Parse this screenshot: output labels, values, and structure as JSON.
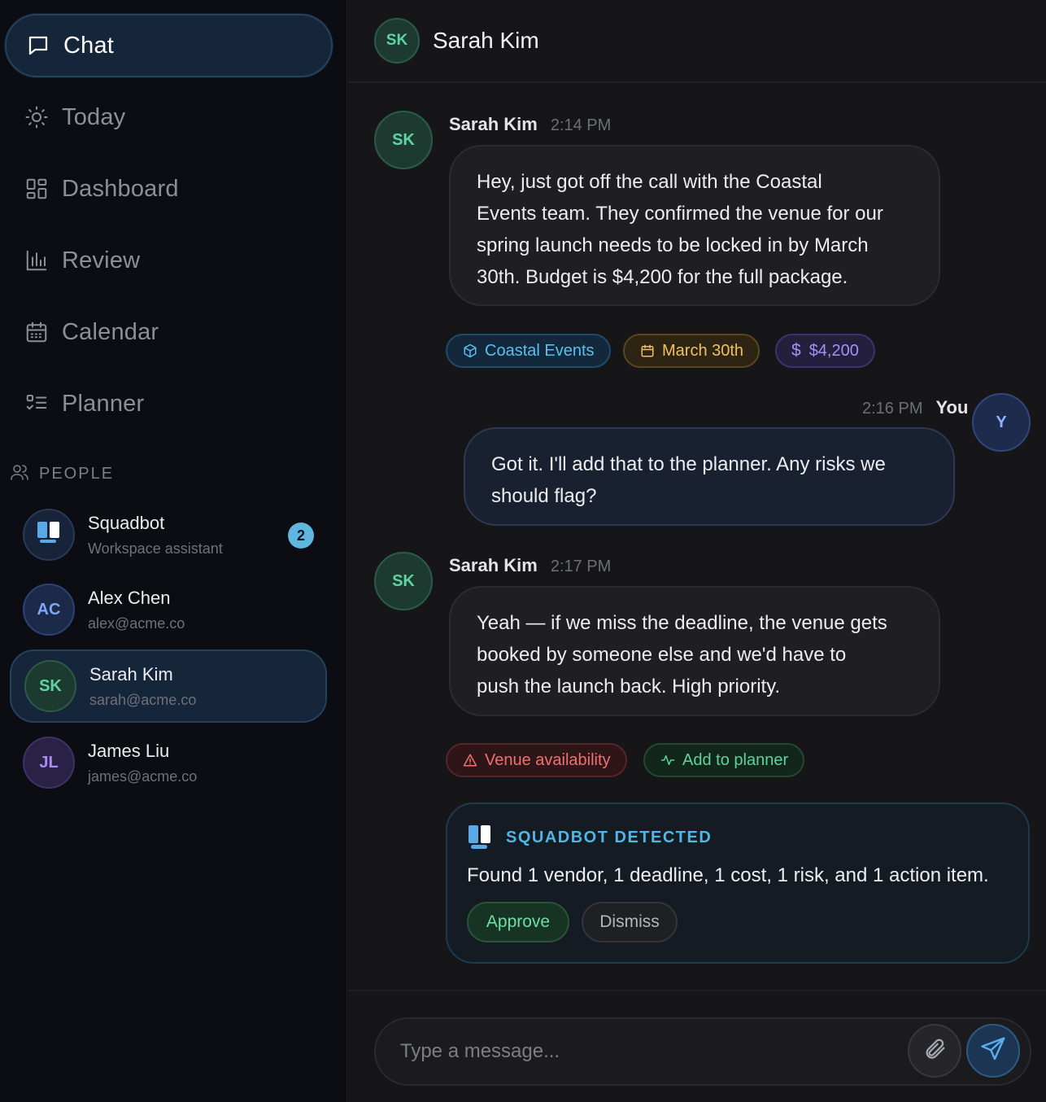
{
  "nav": {
    "chat": "Chat",
    "today": "Today",
    "dashboard": "Dashboard",
    "review": "Review",
    "calendar": "Calendar",
    "planner": "Planner"
  },
  "people": {
    "header": "PEOPLE",
    "items": [
      {
        "name": "Squadbot",
        "sub": "Workspace assistant",
        "badge": "2"
      },
      {
        "name": "Alex Chen",
        "sub": "alex@acme.co",
        "initials": "AC"
      },
      {
        "name": "Sarah Kim",
        "sub": "sarah@acme.co",
        "initials": "SK"
      },
      {
        "name": "James Liu",
        "sub": "james@acme.co",
        "initials": "JL"
      }
    ]
  },
  "conversation": {
    "title": "Sarah Kim",
    "initials": "SK"
  },
  "messages": [
    {
      "author": "Sarah Kim",
      "initials": "SK",
      "time": "2:14 PM",
      "text_lines": [
        "Hey, just got off the call with the Coastal",
        "Events team. They confirmed the venue for our",
        "spring launch needs to be locked in by March",
        "30th. Budget is $4,200 for the full package."
      ],
      "chips": [
        "Coastal Events",
        "March 30th",
        "$4,200"
      ]
    },
    {
      "author": "You",
      "initials": "Y",
      "time": "2:16 PM",
      "text_lines": [
        "Got it. I'll add that to the planner. Any risks we",
        "should flag?"
      ]
    },
    {
      "author": "Sarah Kim",
      "initials": "SK",
      "time": "2:17 PM",
      "text_lines": [
        "Yeah — if we miss the deadline, the venue gets",
        "booked by someone else and we'd have to",
        "push the launch back. High priority."
      ],
      "chips": [
        "Venue availability",
        "Add to planner"
      ]
    }
  ],
  "squadbot": {
    "title": "SQUADBOT DETECTED",
    "text": "Found 1 vendor, 1 deadline, 1 cost, 1 risk, and 1 action item.",
    "approve": "Approve",
    "dismiss": "Dismiss"
  },
  "composer": {
    "placeholder": "Type a message..."
  },
  "colors": {
    "accent": "#4fb6e6",
    "green": "#5fd39a",
    "amber": "#f0c15a",
    "purple": "#a790f5",
    "red": "#f07070"
  }
}
